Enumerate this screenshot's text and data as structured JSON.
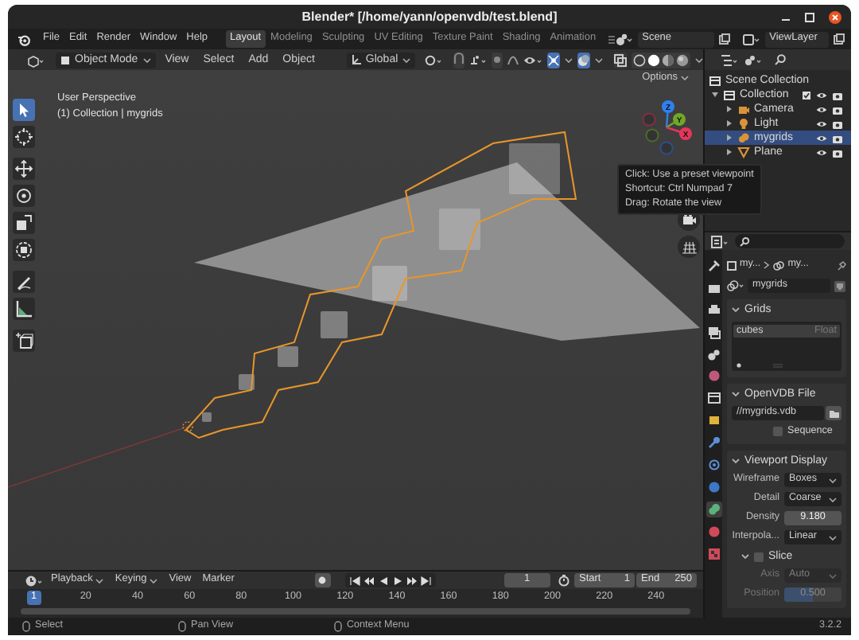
{
  "window": {
    "title": "Blender* [/home/yann/openvdb/test.blend]"
  },
  "menu": [
    "File",
    "Edit",
    "Render",
    "Window",
    "Help"
  ],
  "workspaces": [
    {
      "label": "Layout",
      "selected": true
    },
    {
      "label": "Modeling",
      "selected": false
    },
    {
      "label": "Sculpting",
      "selected": false
    },
    {
      "label": "UV Editing",
      "selected": false
    },
    {
      "label": "Texture Paint",
      "selected": false
    },
    {
      "label": "Shading",
      "selected": false
    },
    {
      "label": "Animation",
      "selected": false
    }
  ],
  "scene": "Scene",
  "view_layer": "ViewLayer",
  "viewport_header": {
    "mode": "Object Mode",
    "menus": [
      "View",
      "Select",
      "Add",
      "Object"
    ],
    "orientation": "Global"
  },
  "viewport": {
    "options": "Options",
    "perspective": "User Perspective",
    "context": "(1) Collection | mygrids",
    "tools": [
      {
        "kind": "select",
        "selected": true
      },
      {
        "kind": "cursor",
        "selected": false
      },
      {
        "kind": "move",
        "selected": false
      },
      {
        "kind": "rotate",
        "selected": false
      },
      {
        "kind": "scale",
        "selected": false
      },
      {
        "kind": "transform",
        "selected": false
      },
      {
        "kind": "annotate",
        "selected": false
      },
      {
        "kind": "measure",
        "selected": false
      },
      {
        "kind": "add_cube",
        "selected": false
      }
    ],
    "axes": [
      {
        "label": "Z",
        "color": "#2f7ff0"
      },
      {
        "label": "Y",
        "color": "#6fa825"
      },
      {
        "label": "X",
        "color": "#e5365a"
      }
    ]
  },
  "tooltip": {
    "lines": [
      "Click: Use a preset viewpoint",
      "Shortcut: Ctrl Numpad 7",
      "Drag: Rotate the view"
    ]
  },
  "outliner": {
    "root": "Scene Collection",
    "items": [
      {
        "label": "Collection",
        "kind": "collection",
        "selected": false,
        "expanded": true,
        "children": [
          {
            "label": "Camera",
            "kind": "camera",
            "selected": false,
            "expanded": false
          },
          {
            "label": "Light",
            "kind": "light",
            "selected": false,
            "expanded": false
          },
          {
            "label": "mygrids",
            "kind": "volume",
            "selected": true,
            "expanded": false
          },
          {
            "label": "Plane",
            "kind": "mesh",
            "selected": false,
            "expanded": false
          }
        ]
      }
    ]
  },
  "properties": {
    "tabs": [
      {
        "kind": "tool",
        "selected": false
      },
      {
        "kind": "render",
        "selected": false
      },
      {
        "kind": "output",
        "selected": false
      },
      {
        "kind": "view_layer",
        "selected": false
      },
      {
        "kind": "scene",
        "selected": false
      },
      {
        "kind": "world",
        "selected": false
      },
      {
        "kind": "collection",
        "selected": false
      },
      {
        "kind": "object",
        "selected": false
      },
      {
        "kind": "modifiers",
        "selected": false
      },
      {
        "kind": "particles",
        "selected": false
      },
      {
        "kind": "physics",
        "selected": false
      },
      {
        "kind": "data",
        "selected": true
      },
      {
        "kind": "material",
        "selected": false
      },
      {
        "kind": "texture",
        "selected": false
      }
    ],
    "breadcrumb": [
      "my...",
      "my..."
    ],
    "data_name": "mygrids",
    "grids": {
      "title": "Grids",
      "expanded": true,
      "items": [
        {
          "name": "cubes",
          "type": "Float",
          "selected": true
        }
      ]
    },
    "file": {
      "title": "OpenVDB File",
      "expanded": true,
      "path": "//mygrids.vdb",
      "sequence": {
        "label": "Sequence",
        "checked": false
      }
    },
    "display": {
      "title": "Viewport Display",
      "expanded": true,
      "fields": [
        {
          "label": "Wireframe",
          "value": "Boxes",
          "kind": "dropdown"
        },
        {
          "label": "Detail",
          "value": "Coarse",
          "kind": "dropdown"
        },
        {
          "label": "Density",
          "value": "9.180",
          "kind": "number"
        },
        {
          "label": "Interpola...",
          "value": "Linear",
          "kind": "dropdown"
        }
      ]
    },
    "slice": {
      "title": "Slice",
      "expanded": true,
      "checked": false,
      "fields": [
        {
          "label": "Axis",
          "value": "Auto",
          "kind": "dropdown",
          "disabled": true
        },
        {
          "label": "Position",
          "value": "0.500",
          "kind": "slider",
          "level": 0.5,
          "disabled": true
        }
      ]
    }
  },
  "timeline": {
    "menus": [
      {
        "label": "Playback",
        "dropdown": true
      },
      {
        "label": "Keying",
        "dropdown": true
      },
      {
        "label": "View",
        "dropdown": false
      },
      {
        "label": "Marker",
        "dropdown": false
      }
    ],
    "current_frame": "1",
    "start_label": "Start",
    "start": "1",
    "end_label": "End",
    "end": "250",
    "ticks": [
      {
        "label": "1",
        "selected": true
      },
      {
        "label": "20",
        "selected": false
      },
      {
        "label": "40",
        "selected": false
      },
      {
        "label": "60",
        "selected": false
      },
      {
        "label": "80",
        "selected": false
      },
      {
        "label": "100",
        "selected": false
      },
      {
        "label": "120",
        "selected": false
      },
      {
        "label": "140",
        "selected": false
      },
      {
        "label": "160",
        "selected": false
      },
      {
        "label": "180",
        "selected": false
      },
      {
        "label": "200",
        "selected": false
      },
      {
        "label": "220",
        "selected": false
      },
      {
        "label": "240",
        "selected": false
      }
    ]
  },
  "status_bar": {
    "hints": [
      "Select",
      "Pan View",
      "Context Menu"
    ],
    "version": "3.2.2"
  }
}
